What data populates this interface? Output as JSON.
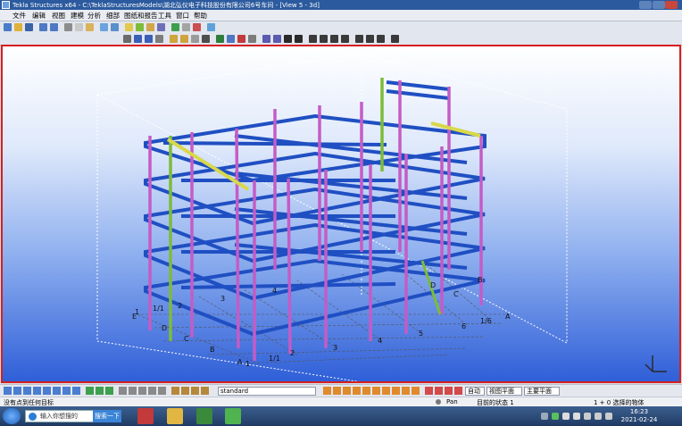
{
  "window": {
    "title": "Tekla Structures x64 - C:\\TeklaStructuresModels\\湖北弘仪电子科技股份有限公司6号车间 - [View 5 - 3d]"
  },
  "menu": [
    "文件",
    "编辑",
    "视图",
    "建模",
    "分析",
    "细部",
    "图纸和报告",
    "工具",
    "窗口",
    "帮助"
  ],
  "statusbar": {
    "view_select": "standard",
    "snap_mode": "自动",
    "plane_1": "视图平面",
    "plane_2": "主要平面"
  },
  "messages": {
    "left": "没有点到任何目标",
    "pan": "Pan",
    "state": "目前的状态 1",
    "selection": "1 + 0 选择的物体"
  },
  "grid_labels": {
    "numbers": [
      "1",
      "1/1",
      "2",
      "3",
      "4",
      "5",
      "6",
      "1/6",
      "1",
      "1/1",
      "2",
      "3",
      "4"
    ],
    "letters": [
      "A",
      "B",
      "C",
      "D",
      "E",
      "A",
      "B",
      "C",
      "D"
    ]
  },
  "taskbar": {
    "search_placeholder": "输入你想搜的",
    "search_button": "搜索一下",
    "time": "16:23",
    "date": "2021-02-24"
  },
  "colors": {
    "viewport_border": "#d62020",
    "beam": "#1f4fc2",
    "column": "#c45cc6",
    "brace": "#7dbb3a"
  }
}
